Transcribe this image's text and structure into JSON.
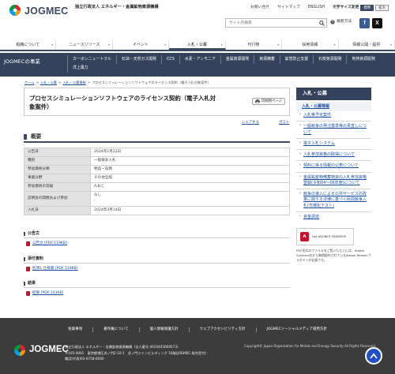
{
  "header": {
    "logo_text": "JOGMEC",
    "org_name": "独立行政法人 エネルギー・金属鉱物資源機構",
    "utility_links": [
      "お問い合せ",
      "サイトマップ",
      "ENGLISH"
    ],
    "font_size_label": "文字サイズ変更",
    "font_sizes": [
      "標準",
      "拡大"
    ],
    "search_placeholder": "サイト内検索",
    "search_howto": "検索方法"
  },
  "gnav": [
    "組織について",
    "ニュースリリース",
    "イベント",
    "入札・公募",
    "刊行物",
    "採用情報",
    "情報公開・提供"
  ],
  "section_nav": {
    "title": "JOGMECの事業",
    "items": [
      "カーボンニュートラル",
      "石油・天然ガス開発",
      "CCS",
      "水素・アンモニア",
      "金属資源開発",
      "資源備蓄",
      "鉱害防止支援",
      "石炭資源開発",
      "地熱資源開発",
      "洋上風力"
    ]
  },
  "breadcrumb": [
    "ホーム",
    "入札・公募",
    "入札・公募情報",
    "プロセスシミュレーションソフトウェアのライセンス契約（電子入札対象案件）"
  ],
  "main": {
    "title": "プロセスシミュレーションソフトウェアのライセンス契約（電子入札対象案件）",
    "print_label": "印刷用ページ",
    "share_label": "シェアする",
    "tweet_label": "ポスト",
    "overview_heading": "概要",
    "table": [
      {
        "label": "公告日",
        "value": "2024年2月22日"
      },
      {
        "label": "種別",
        "value": "一般競争入札"
      },
      {
        "label": "参加資格分類",
        "value": "物品・役務"
      },
      {
        "label": "事業分野",
        "value": "その他全般"
      },
      {
        "label": "参加資格の等級",
        "value": "A,B,C"
      },
      {
        "label": "説明会の開催および参加",
        "value": "なし",
        "value2": "-"
      },
      {
        "label": "入札日",
        "value": "2024年3月14日"
      }
    ],
    "sections": [
      {
        "heading": "公告文",
        "link": "公告文 [PDF:119KB]"
      },
      {
        "heading": "添付資料",
        "link": "別添1 仕様書 [PDF:119KB]"
      },
      {
        "heading": "結果",
        "link": "結果 [PDF:143KB]"
      }
    ]
  },
  "sidebar": {
    "head": "入札・公募",
    "category": "入札・公募情報",
    "items": [
      "入札等予定案件",
      "一般競争の発注基準等の見直しについて",
      "電子入札システム",
      "入札参加資格の取得について",
      "契約に係る情報の公表について",
      "金属鉱産物備蓄物資の入札参加資格登録(令和04～06年度)について",
      "競争の導入による公共サービスの改革に関する法律に基づく民間競争入札(市場化テスト)",
      "資金調達"
    ],
    "reader_label": "Get ADOBE® READER®",
    "reader_note": "PDF形式のファイルをご覧いただくには、Adobe Systems社から無償配布されているAdobe Readerプラグインが必要です。"
  },
  "footer": {
    "links": [
      "免責事項",
      "著作権について",
      "個人情報保護方針",
      "ウェブアクセシビリティ方針",
      "JOGMECソーシャルメディア運用方針"
    ],
    "logo_text": "JOGMEC",
    "address_lines": [
      "独立行政法人 エネルギー・金属鉱物資源機構（法人番号 4010405009573）",
      "〒105-0001　東京都港区虎ノ門2-10-1　虎ノ門ツインビルディング 16階(JOGMEC 総合受付)",
      "電話(代表)03-6758-8000"
    ],
    "copyright": "Copyright© Japan Organization for Metals and Energy Security All Rights Reserved."
  }
}
